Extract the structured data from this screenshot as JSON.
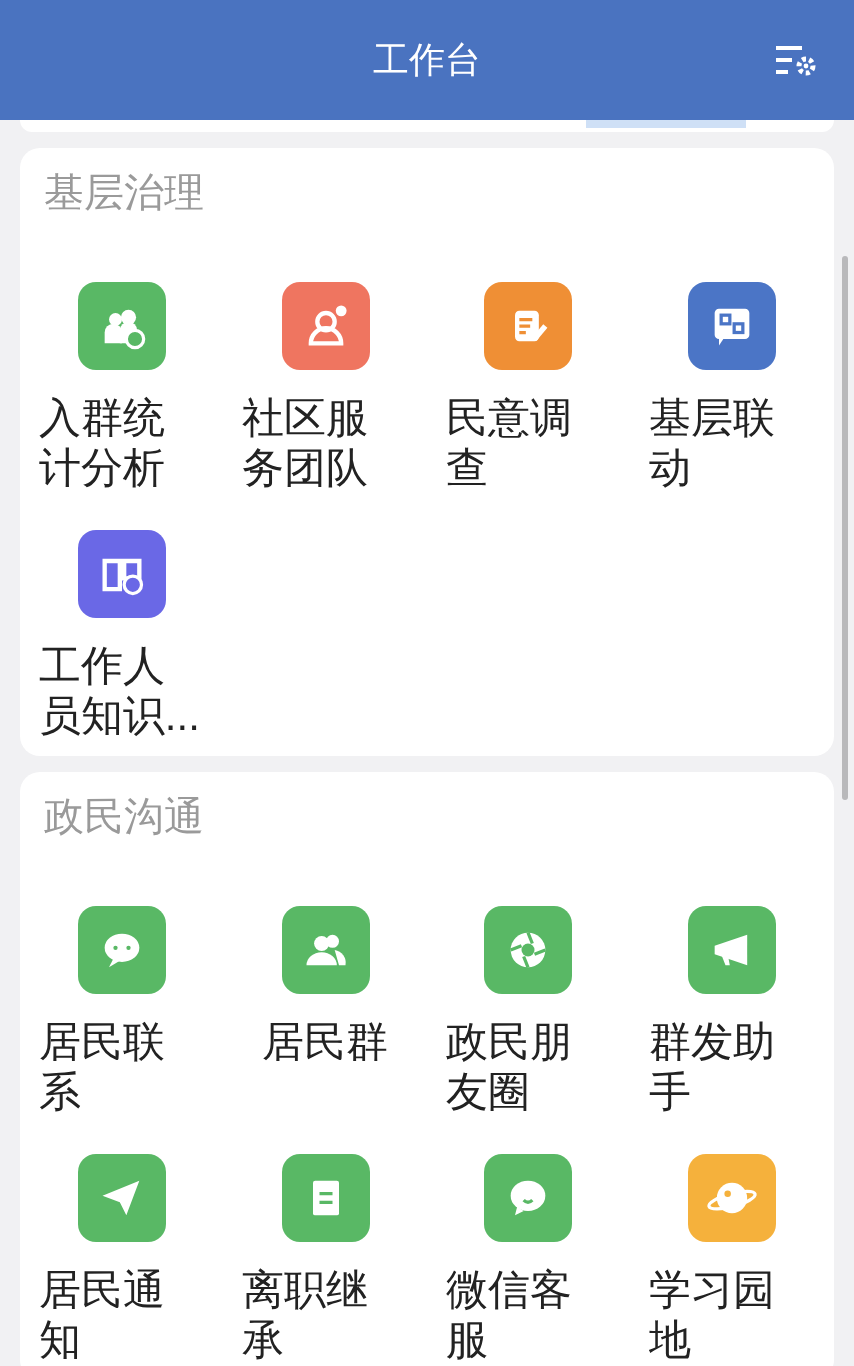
{
  "header": {
    "title": "工作台"
  },
  "sections": [
    {
      "title": "基层治理",
      "items": [
        {
          "label": "入群统计分析",
          "color": "#59b865"
        },
        {
          "label": "社区服务团队",
          "color": "#ef7560"
        },
        {
          "label": "民意调查",
          "color": "#ef8f35"
        },
        {
          "label": "基层联动",
          "color": "#4b75c6"
        },
        {
          "label": "工作人员知识...",
          "color": "#6a68e6"
        }
      ]
    },
    {
      "title": "政民沟通",
      "items": [
        {
          "label": "居民联系",
          "color": "#59b865"
        },
        {
          "label": "居民群",
          "color": "#59b865"
        },
        {
          "label": "政民朋友圈",
          "color": "#59b865"
        },
        {
          "label": "群发助手",
          "color": "#59b865"
        },
        {
          "label": "居民通知",
          "color": "#59b865"
        },
        {
          "label": "离职继承",
          "color": "#59b865"
        },
        {
          "label": "微信客服",
          "color": "#59b865"
        },
        {
          "label": "学习园地",
          "color": "#f5b13c"
        }
      ]
    }
  ]
}
